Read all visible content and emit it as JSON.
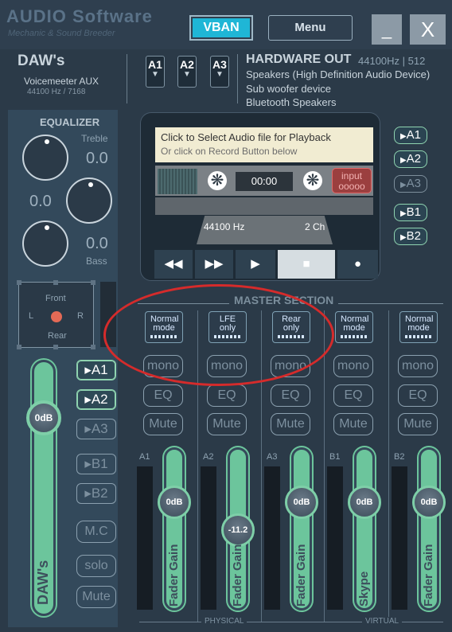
{
  "app": {
    "brand": "AUDIO Software",
    "brand_sub": "Mechanic & Sound Breeder",
    "vban": "VBAN",
    "menu": "Menu",
    "minimize": "_",
    "close": "X"
  },
  "daw": {
    "title": "DAW's",
    "device": "Voicemeeter AUX",
    "rate": "44100 Hz / 7168"
  },
  "bus_selectors": [
    "A1",
    "A2",
    "A3"
  ],
  "hardware_out": {
    "title": "HARDWARE OUT",
    "rate": "44100Hz | 512",
    "devices": [
      "Speakers (High Definition Audio Device)",
      "Sub woofer device",
      "Bluetooth Speakers"
    ]
  },
  "equalizer": {
    "label": "EQUALIZER",
    "treble_label": "Treble",
    "treble_value": "0.0",
    "mid_value": "0.0",
    "bass_label": "Bass",
    "bass_value": "0.0"
  },
  "panner": {
    "front": "Front",
    "rear": "Rear",
    "left": "L",
    "right": "R"
  },
  "daw_strip": {
    "gain": "0dB",
    "name": "DAW's",
    "buses": [
      "A1",
      "A2",
      "A3",
      "B1",
      "B2"
    ],
    "active_buses": [
      "A1",
      "A2"
    ],
    "mc": "M.C",
    "solo": "solo",
    "mute": "Mute"
  },
  "player": {
    "note": "Click to Select Audio file for Playback",
    "note_sub": "Or click on Record Button below",
    "time": "00:00",
    "input": "input",
    "input_dots": "ooooo",
    "sample_rate": "44100 Hz",
    "channels": "2 Ch",
    "buses": [
      "A1",
      "A2",
      "A3",
      "B1",
      "B2"
    ],
    "active_buses": [
      "A1",
      "A2",
      "B1",
      "B2"
    ],
    "transport": [
      "rewind",
      "fast-forward",
      "play",
      "stop",
      "record"
    ]
  },
  "master": {
    "label": "MASTER SECTION",
    "physical": "PHYSICAL",
    "virtual": "VIRTUAL",
    "strips": [
      {
        "bus": "A1",
        "mode": "Normal mode",
        "gain": "0dB",
        "name": "Fader Gain",
        "level": 0.62
      },
      {
        "bus": "A2",
        "mode": "LFE only",
        "gain": "-11.2",
        "name": "Fader Gain",
        "level": 0.45
      },
      {
        "bus": "A3",
        "mode": "Rear only",
        "gain": "0dB",
        "name": "Fader Gain",
        "level": 0.62
      },
      {
        "bus": "B1",
        "mode": "Normal mode",
        "gain": "0dB",
        "name": "Skype",
        "level": 0.62
      },
      {
        "bus": "B2",
        "mode": "Normal mode",
        "gain": "0dB",
        "name": "Fader Gain",
        "level": 0.62
      }
    ],
    "mono": "mono",
    "eq": "EQ",
    "mute": "Mute"
  },
  "colors": {
    "accent": "#6cc59c",
    "vban": "#1fb6d6",
    "highlight": "#d52b2b",
    "record": "#9b3f3f"
  }
}
